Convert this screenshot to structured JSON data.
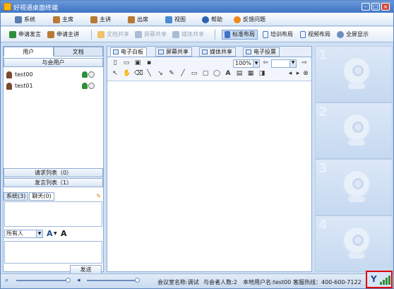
{
  "window": {
    "title": "好视通桌面终端"
  },
  "menu": [
    {
      "label": "系统",
      "icon": "gear-icon"
    },
    {
      "label": "主席",
      "icon": "person-icon"
    },
    {
      "label": "主讲",
      "icon": "person-icon"
    },
    {
      "label": "出席",
      "icon": "person-icon"
    },
    {
      "label": "视图",
      "icon": "view-icon"
    },
    {
      "label": "帮助",
      "icon": "help-icon"
    },
    {
      "label": "反馈问题",
      "icon": "feedback-icon"
    }
  ],
  "toolbar": {
    "request_speak": "申请发言",
    "request_present": "申请主讲",
    "doc_share": "文档共享",
    "screen_share": "屏幕共享",
    "media_share": "媒体共享",
    "layout_standard": "标准布局",
    "layout_training": "培训布局",
    "layout_video": "视频布局",
    "fullscreen": "全屏显示"
  },
  "left": {
    "tab_users": "用户",
    "tab_docs": "文档",
    "attendees_header": "与会用户",
    "users": [
      {
        "name": "test00"
      },
      {
        "name": "test01"
      }
    ],
    "request_list": "请求列表（0）",
    "speak_list": "发言列表（1）",
    "chat_tabs": [
      "系统(3)",
      "聊天(0)"
    ],
    "recipient": "所有人",
    "send_label": "发送"
  },
  "center": {
    "tabs": [
      "电子白板",
      "屏幕共享",
      "媒体共享",
      "电子投票"
    ],
    "zoom": "100%"
  },
  "right": {
    "slots": [
      "1",
      "2",
      "3",
      "4"
    ]
  },
  "status": {
    "room": "会议室名称:调试",
    "count": "与会者人数:2",
    "local_user": "本地用户名:test00",
    "hotline": "客服热线：400-600-7122"
  },
  "colors": {
    "accent": "#3f74c4",
    "highlight": "#e00000"
  }
}
